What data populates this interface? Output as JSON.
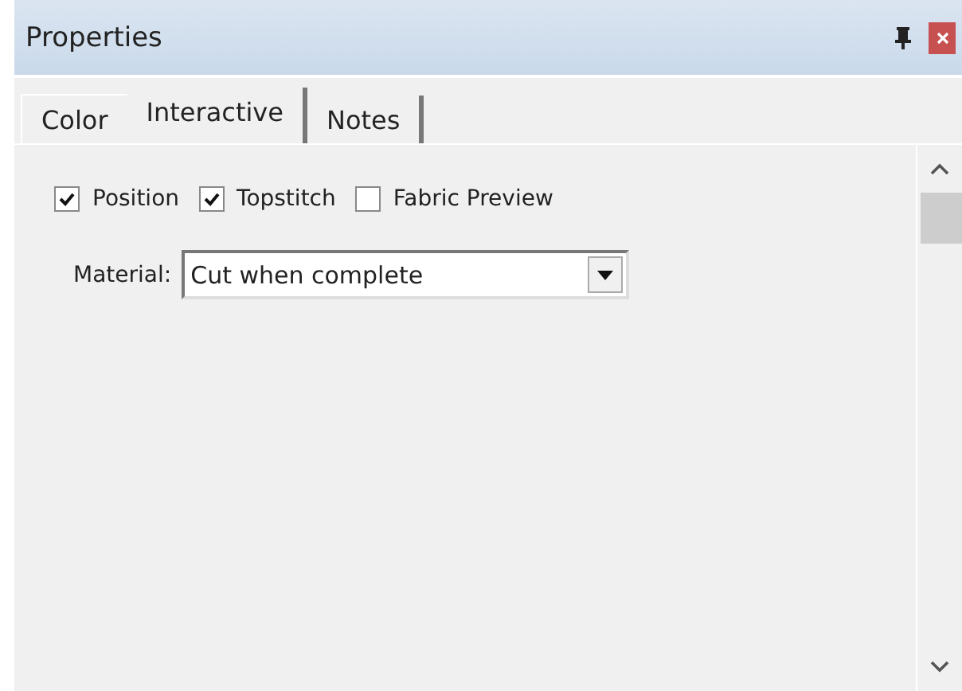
{
  "window": {
    "title": "Properties"
  },
  "tabs": [
    {
      "label": "Color",
      "selected": false
    },
    {
      "label": "Interactive",
      "selected": true
    },
    {
      "label": "Notes",
      "selected": false
    }
  ],
  "checkboxes": [
    {
      "label": "Position",
      "checked": true
    },
    {
      "label": "Topstitch",
      "checked": true
    },
    {
      "label": "Fabric Preview",
      "checked": false
    }
  ],
  "material": {
    "label": "Material:",
    "value": "Cut when complete"
  }
}
